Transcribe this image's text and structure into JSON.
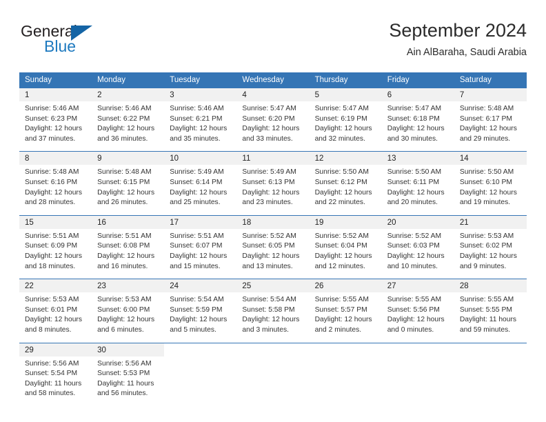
{
  "brand": {
    "word_top": "General",
    "word_bottom": "Blue",
    "triangle_color": "#1464a5",
    "blue_color": "#1d79bf"
  },
  "header": {
    "title": "September 2024",
    "subtitle": "Ain AlBaraha, Saudi Arabia"
  },
  "theme": {
    "header_blue": "#3575b5",
    "day_number_bg": "#f1f1f1",
    "cell_bg": "#ffffff",
    "text": "#333333"
  },
  "weekdays": [
    "Sunday",
    "Monday",
    "Tuesday",
    "Wednesday",
    "Thursday",
    "Friday",
    "Saturday"
  ],
  "weeks": [
    [
      {
        "day": "1",
        "sunrise": "Sunrise: 5:46 AM",
        "sunset": "Sunset: 6:23 PM",
        "daylight1": "Daylight: 12 hours",
        "daylight2": "and 37 minutes."
      },
      {
        "day": "2",
        "sunrise": "Sunrise: 5:46 AM",
        "sunset": "Sunset: 6:22 PM",
        "daylight1": "Daylight: 12 hours",
        "daylight2": "and 36 minutes."
      },
      {
        "day": "3",
        "sunrise": "Sunrise: 5:46 AM",
        "sunset": "Sunset: 6:21 PM",
        "daylight1": "Daylight: 12 hours",
        "daylight2": "and 35 minutes."
      },
      {
        "day": "4",
        "sunrise": "Sunrise: 5:47 AM",
        "sunset": "Sunset: 6:20 PM",
        "daylight1": "Daylight: 12 hours",
        "daylight2": "and 33 minutes."
      },
      {
        "day": "5",
        "sunrise": "Sunrise: 5:47 AM",
        "sunset": "Sunset: 6:19 PM",
        "daylight1": "Daylight: 12 hours",
        "daylight2": "and 32 minutes."
      },
      {
        "day": "6",
        "sunrise": "Sunrise: 5:47 AM",
        "sunset": "Sunset: 6:18 PM",
        "daylight1": "Daylight: 12 hours",
        "daylight2": "and 30 minutes."
      },
      {
        "day": "7",
        "sunrise": "Sunrise: 5:48 AM",
        "sunset": "Sunset: 6:17 PM",
        "daylight1": "Daylight: 12 hours",
        "daylight2": "and 29 minutes."
      }
    ],
    [
      {
        "day": "8",
        "sunrise": "Sunrise: 5:48 AM",
        "sunset": "Sunset: 6:16 PM",
        "daylight1": "Daylight: 12 hours",
        "daylight2": "and 28 minutes."
      },
      {
        "day": "9",
        "sunrise": "Sunrise: 5:48 AM",
        "sunset": "Sunset: 6:15 PM",
        "daylight1": "Daylight: 12 hours",
        "daylight2": "and 26 minutes."
      },
      {
        "day": "10",
        "sunrise": "Sunrise: 5:49 AM",
        "sunset": "Sunset: 6:14 PM",
        "daylight1": "Daylight: 12 hours",
        "daylight2": "and 25 minutes."
      },
      {
        "day": "11",
        "sunrise": "Sunrise: 5:49 AM",
        "sunset": "Sunset: 6:13 PM",
        "daylight1": "Daylight: 12 hours",
        "daylight2": "and 23 minutes."
      },
      {
        "day": "12",
        "sunrise": "Sunrise: 5:50 AM",
        "sunset": "Sunset: 6:12 PM",
        "daylight1": "Daylight: 12 hours",
        "daylight2": "and 22 minutes."
      },
      {
        "day": "13",
        "sunrise": "Sunrise: 5:50 AM",
        "sunset": "Sunset: 6:11 PM",
        "daylight1": "Daylight: 12 hours",
        "daylight2": "and 20 minutes."
      },
      {
        "day": "14",
        "sunrise": "Sunrise: 5:50 AM",
        "sunset": "Sunset: 6:10 PM",
        "daylight1": "Daylight: 12 hours",
        "daylight2": "and 19 minutes."
      }
    ],
    [
      {
        "day": "15",
        "sunrise": "Sunrise: 5:51 AM",
        "sunset": "Sunset: 6:09 PM",
        "daylight1": "Daylight: 12 hours",
        "daylight2": "and 18 minutes."
      },
      {
        "day": "16",
        "sunrise": "Sunrise: 5:51 AM",
        "sunset": "Sunset: 6:08 PM",
        "daylight1": "Daylight: 12 hours",
        "daylight2": "and 16 minutes."
      },
      {
        "day": "17",
        "sunrise": "Sunrise: 5:51 AM",
        "sunset": "Sunset: 6:07 PM",
        "daylight1": "Daylight: 12 hours",
        "daylight2": "and 15 minutes."
      },
      {
        "day": "18",
        "sunrise": "Sunrise: 5:52 AM",
        "sunset": "Sunset: 6:05 PM",
        "daylight1": "Daylight: 12 hours",
        "daylight2": "and 13 minutes."
      },
      {
        "day": "19",
        "sunrise": "Sunrise: 5:52 AM",
        "sunset": "Sunset: 6:04 PM",
        "daylight1": "Daylight: 12 hours",
        "daylight2": "and 12 minutes."
      },
      {
        "day": "20",
        "sunrise": "Sunrise: 5:52 AM",
        "sunset": "Sunset: 6:03 PM",
        "daylight1": "Daylight: 12 hours",
        "daylight2": "and 10 minutes."
      },
      {
        "day": "21",
        "sunrise": "Sunrise: 5:53 AM",
        "sunset": "Sunset: 6:02 PM",
        "daylight1": "Daylight: 12 hours",
        "daylight2": "and 9 minutes."
      }
    ],
    [
      {
        "day": "22",
        "sunrise": "Sunrise: 5:53 AM",
        "sunset": "Sunset: 6:01 PM",
        "daylight1": "Daylight: 12 hours",
        "daylight2": "and 8 minutes."
      },
      {
        "day": "23",
        "sunrise": "Sunrise: 5:53 AM",
        "sunset": "Sunset: 6:00 PM",
        "daylight1": "Daylight: 12 hours",
        "daylight2": "and 6 minutes."
      },
      {
        "day": "24",
        "sunrise": "Sunrise: 5:54 AM",
        "sunset": "Sunset: 5:59 PM",
        "daylight1": "Daylight: 12 hours",
        "daylight2": "and 5 minutes."
      },
      {
        "day": "25",
        "sunrise": "Sunrise: 5:54 AM",
        "sunset": "Sunset: 5:58 PM",
        "daylight1": "Daylight: 12 hours",
        "daylight2": "and 3 minutes."
      },
      {
        "day": "26",
        "sunrise": "Sunrise: 5:55 AM",
        "sunset": "Sunset: 5:57 PM",
        "daylight1": "Daylight: 12 hours",
        "daylight2": "and 2 minutes."
      },
      {
        "day": "27",
        "sunrise": "Sunrise: 5:55 AM",
        "sunset": "Sunset: 5:56 PM",
        "daylight1": "Daylight: 12 hours",
        "daylight2": "and 0 minutes."
      },
      {
        "day": "28",
        "sunrise": "Sunrise: 5:55 AM",
        "sunset": "Sunset: 5:55 PM",
        "daylight1": "Daylight: 11 hours",
        "daylight2": "and 59 minutes."
      }
    ],
    [
      {
        "day": "29",
        "sunrise": "Sunrise: 5:56 AM",
        "sunset": "Sunset: 5:54 PM",
        "daylight1": "Daylight: 11 hours",
        "daylight2": "and 58 minutes."
      },
      {
        "day": "30",
        "sunrise": "Sunrise: 5:56 AM",
        "sunset": "Sunset: 5:53 PM",
        "daylight1": "Daylight: 11 hours",
        "daylight2": "and 56 minutes."
      },
      null,
      null,
      null,
      null,
      null
    ]
  ]
}
